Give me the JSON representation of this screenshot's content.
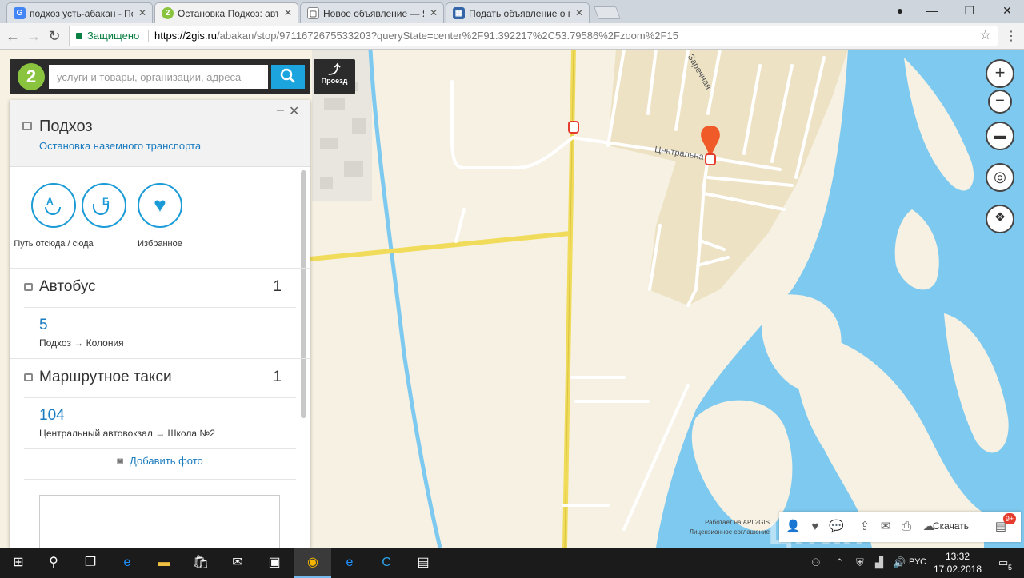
{
  "browser": {
    "tabs": [
      {
        "title": "подхоз усть-абакан - По",
        "favicon_color": "#4285f4",
        "favicon": "G"
      },
      {
        "title": "Остановка Подхоз: авто",
        "favicon_color": "#8ac43f",
        "favicon": "2"
      },
      {
        "title": "Новое объявление — Я",
        "favicon_color": "#888888",
        "favicon": "▢"
      },
      {
        "title": "Подать объявление о пр",
        "favicon_color": "#3466a8",
        "favicon": "▦"
      }
    ],
    "secure_label": "Защищено",
    "url_host": "https://2gis.ru",
    "url_rest": "/abakan/stop/9711672675533203?queryState=center%2F91.392217%2C53.79586%2Fzoom%2F15"
  },
  "search": {
    "placeholder": "услуги и товары, организации, адреса",
    "route_label": "Проезд",
    "logo": "2"
  },
  "stop": {
    "title": "Подхоз",
    "subtitle": "Остановка наземного транспорта",
    "actions": [
      {
        "label": "Путь отсюда / сюда"
      },
      {
        "label": "Избранное"
      }
    ]
  },
  "transport": [
    {
      "title": "Автобус",
      "count": "1",
      "route": "5",
      "desc": "Подхоз → Колония"
    },
    {
      "title": "Маршрутное такси",
      "count": "1",
      "route": "104",
      "desc": "Центральный автовокзал → Школа №2"
    }
  ],
  "add_photo": "Добавить фото",
  "map": {
    "street_labels": [
      "Центральна",
      "Заречная"
    ],
    "api_line1": "Работает на API 2GIS",
    "api_line2": "Лицензионное соглашение",
    "download": "Скачать",
    "badge": "9+",
    "colors": {
      "water": "#7ec9ef",
      "land": "#f6f1e2",
      "residential": "#ede2c4",
      "road": "#f0dc5a",
      "marker": "#f05a28"
    }
  },
  "taskbar": {
    "lang": "РУС",
    "time": "13:32",
    "date": "17.02.2018",
    "notif": "5"
  }
}
